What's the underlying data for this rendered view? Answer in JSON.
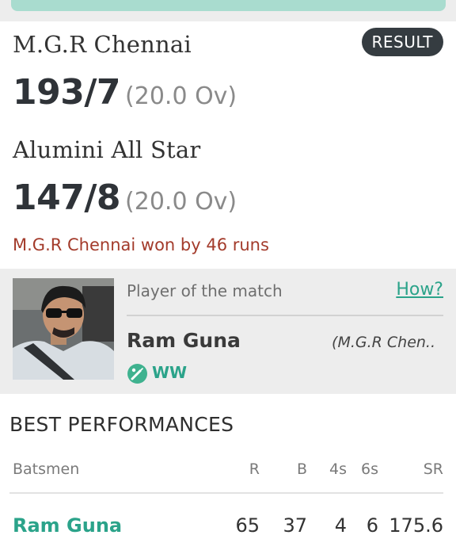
{
  "match": {
    "team1": {
      "name": "M.G.R Chennai",
      "score": "193/7",
      "overs": "(20.0 Ov)"
    },
    "team2": {
      "name": "Alumini All Star",
      "score": "147/8",
      "overs": "(20.0 Ov)"
    },
    "badge": "RESULT",
    "result_text": "M.G.R Chennai won by 46 runs"
  },
  "potm": {
    "label": "Player of the match",
    "how_link": "How?",
    "player_name": "Ram Guna",
    "team": "(M.G.R Chen..",
    "role_icon": "batsman-icon",
    "role": "WW"
  },
  "best": {
    "title": "BEST PERFORMANCES",
    "headers": {
      "name": "Batsmen",
      "r": "R",
      "b": "B",
      "fours": "4s",
      "sixes": "6s",
      "sr": "SR"
    },
    "rows": [
      {
        "name": "Ram Guna",
        "r": "65",
        "b": "37",
        "fours": "4",
        "sixes": "6",
        "sr": "175.6"
      }
    ]
  },
  "colors": {
    "accent": "#2ba38a",
    "result": "#a33b2b",
    "badge": "#353c41",
    "top_band": "#a9dccf"
  }
}
